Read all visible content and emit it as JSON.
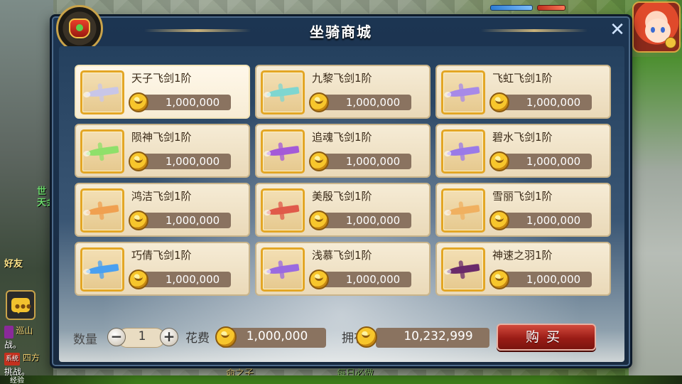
{
  "shop": {
    "title": "坐骑商城",
    "close_glyph": "✕",
    "items": [
      {
        "name": "天子飞剑1阶",
        "price": "1,000,000",
        "color": "#c8c6e8",
        "icon": "flying-sword-icon"
      },
      {
        "name": "九黎飞剑1阶",
        "price": "1,000,000",
        "color": "#7fd6d0",
        "icon": "flying-sword-icon"
      },
      {
        "name": "飞虹飞剑1阶",
        "price": "1,000,000",
        "color": "#a78ae8",
        "icon": "flying-sword-icon"
      },
      {
        "name": "陨神飞剑1阶",
        "price": "1,000,000",
        "color": "#8fe06a",
        "icon": "flying-sword-icon"
      },
      {
        "name": "追魂飞剑1阶",
        "price": "1,000,000",
        "color": "#a45ad8",
        "icon": "flying-sword-icon"
      },
      {
        "name": "碧水飞剑1阶",
        "price": "1,000,000",
        "color": "#9a7ae8",
        "icon": "flying-sword-icon"
      },
      {
        "name": "鸿洁飞剑1阶",
        "price": "1,000,000",
        "color": "#f0a050",
        "icon": "flying-sword-icon"
      },
      {
        "name": "美殷飞剑1阶",
        "price": "1,000,000",
        "color": "#e05a4a",
        "icon": "flying-sword-icon"
      },
      {
        "name": "雪丽飞剑1阶",
        "price": "1,000,000",
        "color": "#f0b060",
        "icon": "flying-sword-icon"
      },
      {
        "name": "巧倩飞剑1阶",
        "price": "1,000,000",
        "color": "#4aa0f0",
        "icon": "flying-sword-icon"
      },
      {
        "name": "浅慕飞剑1阶",
        "price": "1,000,000",
        "color": "#9a6ae0",
        "icon": "flying-sword-icon"
      },
      {
        "name": "神速之羽1阶",
        "price": "1,000,000",
        "color": "#6a2a6a",
        "icon": "wing-crest-icon"
      }
    ],
    "selected_index": 0,
    "quantity_label": "数量",
    "quantity": "1",
    "minus_glyph": "−",
    "plus_glyph": "+",
    "cost_label": "花费",
    "cost": "1,000,000",
    "balance_label": "拥有",
    "balance": "10,232,999",
    "buy_label": "购买"
  },
  "background": {
    "left_text_1": "世",
    "left_text_2": "天会",
    "friend_label": "好友",
    "chat_line_1": "战。",
    "chat_line_2": "挑战。",
    "chat_tag": "系统",
    "chat_side_1": "巡山",
    "chat_side_2": "四方",
    "under_left": "命之子",
    "under_right": "每日必做",
    "exp_label": "经验"
  },
  "colors": {
    "panel_bg": "#1c3552",
    "card_bg": "#f6ecd6",
    "price_pill": "#8a7360",
    "buy_button": "#9a1c16",
    "gold_coin": "#f7c62c"
  }
}
